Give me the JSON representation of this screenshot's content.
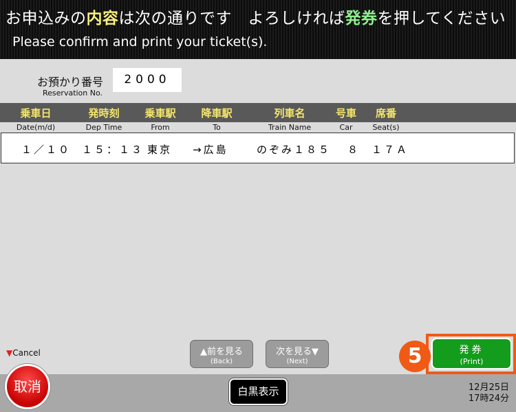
{
  "header": {
    "jp": {
      "p1": "お申込みの",
      "h1": "内容",
      "p2": "は次の通りです　よろしければ",
      "h2": "発券",
      "p3": "を押してください"
    },
    "en": "Please confirm and print your ticket(s).",
    "highlight_colors": {
      "content": "#f8f07a",
      "ticket": "#8ef08e"
    }
  },
  "reservation": {
    "label_jp": "お預かり番号",
    "label_en": "Reservation No.",
    "value": "2000"
  },
  "table": {
    "columns": [
      {
        "jp": "乗車日",
        "en": "Date(m/d)"
      },
      {
        "jp": "発時刻",
        "en": "Dep Time"
      },
      {
        "jp": "乗車駅",
        "en": "From"
      },
      {
        "jp": "降車駅",
        "en": "To"
      },
      {
        "jp": "列車名",
        "en": "Train Name"
      },
      {
        "jp": "号車",
        "en": "Car"
      },
      {
        "jp": "席番",
        "en": "Seat(s)"
      }
    ],
    "rows": [
      [
        "１／１０",
        "１５：１３",
        "東京",
        "→広島",
        "のぞみ１８５",
        "８",
        "１７Ａ"
      ]
    ]
  },
  "nav": {
    "prev": {
      "label": "▲前を見る",
      "sub": "(Back)"
    },
    "next": {
      "label": "次を見る▼",
      "sub": "(Next)"
    }
  },
  "cancel": {
    "hint": "Cancel",
    "label": "取消",
    "color": "#e02020"
  },
  "mono_button": {
    "label": "白黒表示"
  },
  "print_button": {
    "label": "発券",
    "sub": "(Print)",
    "color": "#149c1c"
  },
  "step_badge": {
    "number": "5",
    "color": "#f05a14"
  },
  "datetime": {
    "date": "12月25日",
    "time": "17時24分"
  }
}
